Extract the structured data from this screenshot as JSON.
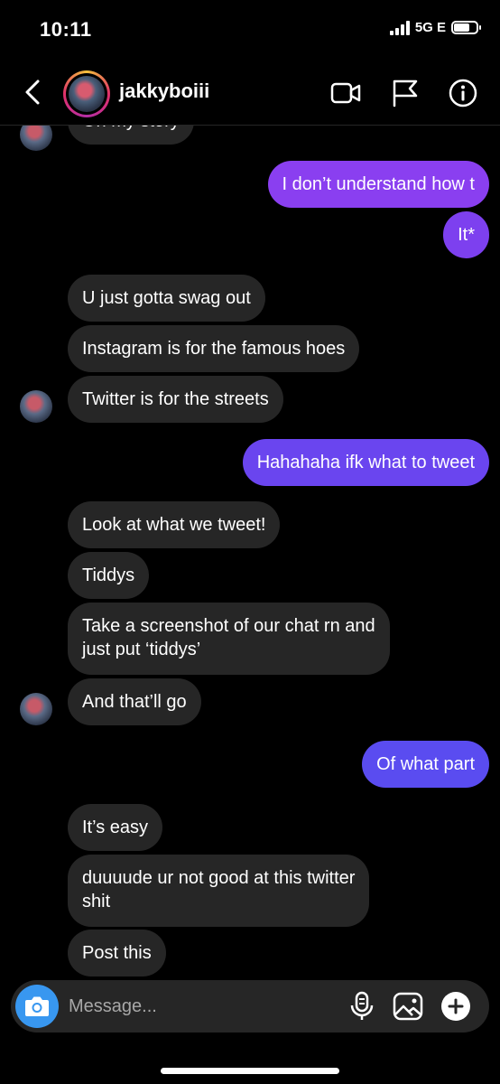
{
  "status": {
    "time": "10:11",
    "network": "5G E",
    "battery_level": 0.7
  },
  "header": {
    "username": "jakkyboiii"
  },
  "messages": [
    {
      "from": "them",
      "text": "On my story"
    },
    {
      "from": "me",
      "text": "I don’t understand how t"
    },
    {
      "from": "me",
      "text": "It*"
    },
    {
      "from": "them",
      "text": "U just gotta swag out"
    },
    {
      "from": "them",
      "text": "Instagram is for the famous hoes"
    },
    {
      "from": "them",
      "text": "Twitter is for the streets"
    },
    {
      "from": "me",
      "text": "Hahahaha ifk what to tweet"
    },
    {
      "from": "them",
      "text": "Look at what we tweet!"
    },
    {
      "from": "them",
      "text": "Tiddys"
    },
    {
      "from": "them",
      "line1": "Take a screenshot of our chat rn and",
      "line2": "just put ‘tiddys’"
    },
    {
      "from": "them",
      "text": "And that’ll go"
    },
    {
      "from": "me",
      "text": "Of what part"
    },
    {
      "from": "them",
      "text": "It’s easy"
    },
    {
      "from": "them",
      "line1": "duuuude ur not good at this twitter",
      "line2": "shit"
    },
    {
      "from": "them",
      "text": "Post this"
    }
  ],
  "composer": {
    "placeholder": "Message..."
  },
  "colors": {
    "me_bubble_top": "#8a3ff0",
    "me_bubble_bottom": "#5a4cf0",
    "them_bubble": "#262626",
    "camera_button": "#3897f0"
  },
  "icons": [
    "back-icon",
    "video-call-icon",
    "flag-icon",
    "info-icon",
    "camera-icon",
    "microphone-icon",
    "gallery-icon",
    "plus-icon"
  ]
}
